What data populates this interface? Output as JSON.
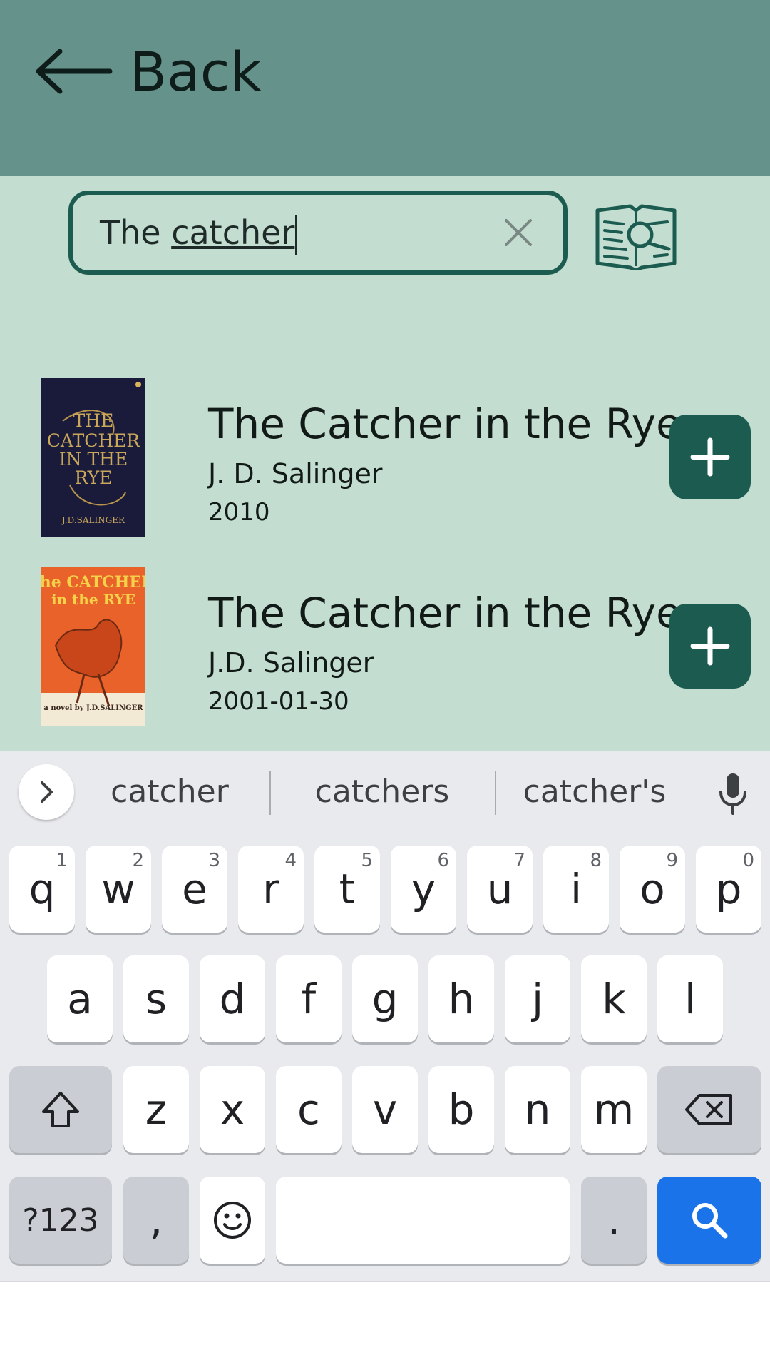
{
  "header": {
    "back_label": "Back"
  },
  "search": {
    "value_plain": "The ",
    "value_underlined": "catcher"
  },
  "results": [
    {
      "title": "The Catcher in the Rye",
      "author": "J. D. Salinger",
      "year": "2010"
    },
    {
      "title": "The Catcher in the Rye",
      "author": "J.D. Salinger",
      "year": "2001-01-30"
    }
  ],
  "keyboard": {
    "suggestions": [
      "catcher",
      "catchers",
      "catcher's"
    ],
    "row1": [
      {
        "k": "q",
        "h": "1"
      },
      {
        "k": "w",
        "h": "2"
      },
      {
        "k": "e",
        "h": "3"
      },
      {
        "k": "r",
        "h": "4"
      },
      {
        "k": "t",
        "h": "5"
      },
      {
        "k": "y",
        "h": "6"
      },
      {
        "k": "u",
        "h": "7"
      },
      {
        "k": "i",
        "h": "8"
      },
      {
        "k": "o",
        "h": "9"
      },
      {
        "k": "p",
        "h": "0"
      }
    ],
    "row2": [
      "a",
      "s",
      "d",
      "f",
      "g",
      "h",
      "j",
      "k",
      "l"
    ],
    "row3": [
      "z",
      "x",
      "c",
      "v",
      "b",
      "n",
      "m"
    ],
    "symbols_label": "?123",
    "comma": ",",
    "period": "."
  },
  "colors": {
    "header_bg": "#65928a",
    "content_bg": "#c3ddd0",
    "accent": "#1c5c50",
    "search_key": "#1a73e8"
  }
}
